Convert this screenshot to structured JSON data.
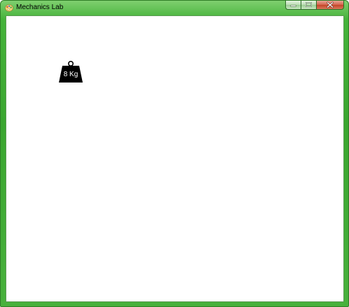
{
  "window": {
    "title": "Mechanics Lab",
    "app_icon": "paint-palette-icon",
    "accent_color": "#3aa62f",
    "caption_buttons": {
      "minimize_icon": "minimize-icon",
      "maximize_icon": "maximize-icon",
      "close_icon": "close-icon"
    }
  },
  "canvas": {
    "weight": {
      "icon": "kettlebell-weight-icon",
      "label": "8 Kg"
    }
  }
}
